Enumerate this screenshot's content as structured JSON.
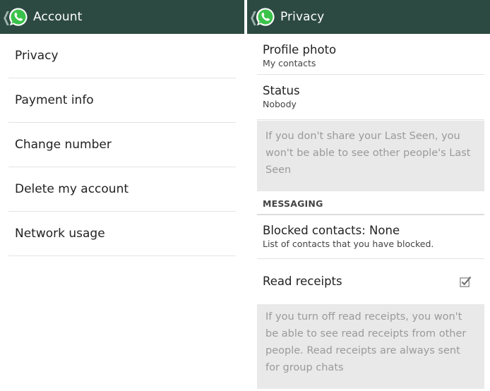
{
  "left_screen": {
    "action_bar": {
      "title": "Account",
      "logo_icon": "whatsapp-logo-icon",
      "back_icon": "chevron-left-icon"
    },
    "items": [
      {
        "label": "Privacy"
      },
      {
        "label": "Payment info"
      },
      {
        "label": "Change number"
      },
      {
        "label": "Delete my account"
      },
      {
        "label": "Network usage"
      }
    ]
  },
  "right_screen": {
    "action_bar": {
      "title": "Privacy",
      "logo_icon": "whatsapp-logo-icon",
      "back_icon": "chevron-left-icon"
    },
    "profile_photo": {
      "title": "Profile photo",
      "summary": "My contacts"
    },
    "status": {
      "title": "Status",
      "summary": "Nobody"
    },
    "last_seen_note": "If you don't share your Last Seen, you won't be able to see other people's Last Seen",
    "messaging_header": "MESSAGING",
    "blocked_contacts": {
      "title": "Blocked contacts: None",
      "summary": "List of contacts that you have blocked."
    },
    "read_receipts": {
      "title": "Read receipts",
      "checked": true
    },
    "read_receipts_note": "If you turn off read receipts, you won't be able to see read receipts from other people. Read receipts are always sent for group chats"
  },
  "colors": {
    "action_bar": "#2d4a42",
    "logo_green": "#3bc24a",
    "info_box_bg": "#e9e9e9",
    "info_box_text": "#9a9a9a"
  }
}
